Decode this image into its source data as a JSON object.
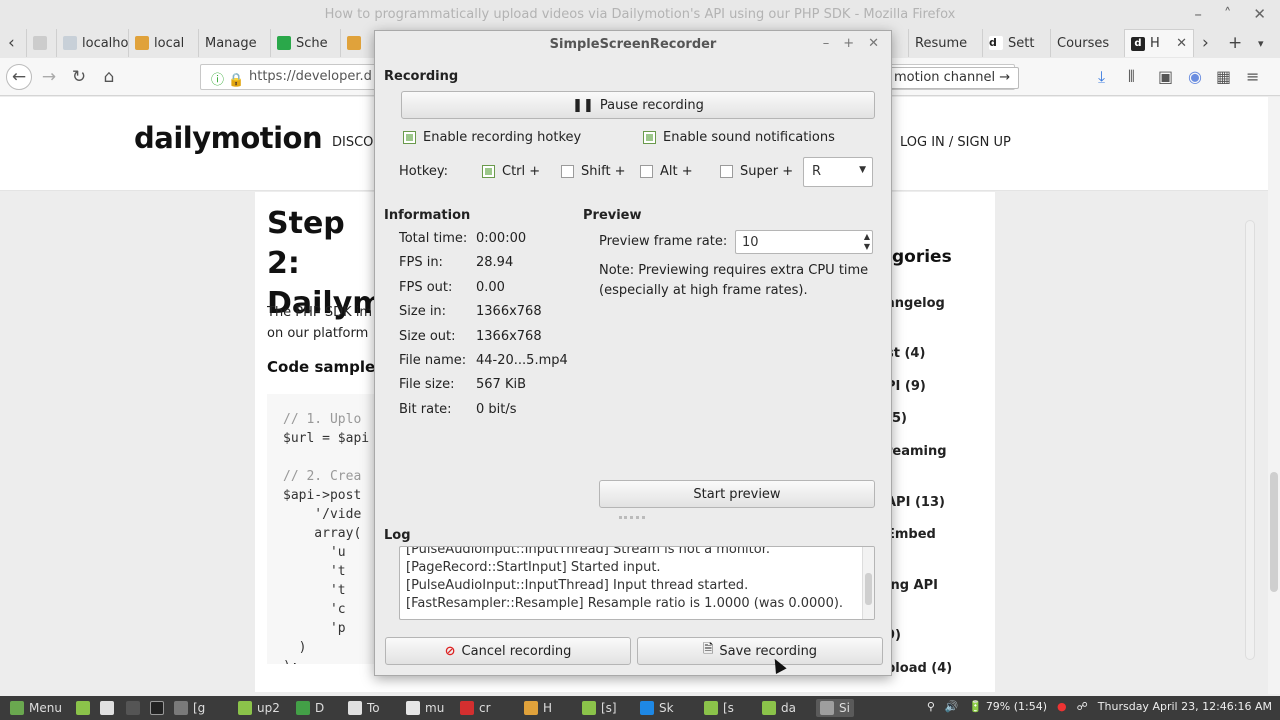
{
  "browser": {
    "window_title": "How to programmatically upload videos via Dailymotion's API using our PHP SDK - Mozilla Firefox",
    "tabs": [
      {
        "label": "localho",
        "icon_color": "#9aa5b1"
      },
      {
        "label": "local",
        "icon_color": "#e0a23b"
      },
      {
        "label": "Manage",
        "icon_color": "#e6e6e6"
      },
      {
        "label": "Sche",
        "icon_color": "#2aa84a"
      },
      {
        "label": "Resume",
        "icon_color": "#e0a23b"
      },
      {
        "label": "Sett",
        "icon_color": "#222222"
      },
      {
        "label": "Courses",
        "icon_color": "#e6e6e6"
      },
      {
        "label": "H",
        "icon_color": "#222222"
      }
    ],
    "url": "https://developer.d",
    "url_chip": "motion channel"
  },
  "website": {
    "logo": "dailymotion",
    "nav_text": "DISCO",
    "login": "LOG IN / SIGN UP",
    "step_title": "Step 2: Dailym",
    "intro": "The PHP SDK im on our platform",
    "code_header": "Code sample",
    "code_lines": [
      {
        "t": "// 1. Uplo",
        "c": true
      },
      {
        "t": "$url = $api",
        "c": false
      },
      {
        "t": "",
        "c": false
      },
      {
        "t": "// 2. Crea",
        "c": true
      },
      {
        "t": "$api->post",
        "c": false
      },
      {
        "t": "    '/vide",
        "c": false
      },
      {
        "t": "    array(",
        "c": false
      },
      {
        "t": "      'u",
        "c": false
      },
      {
        "t": "      't",
        "c": false
      },
      {
        "t": "      't",
        "c": false
      },
      {
        "t": "      'c",
        "c": false
      },
      {
        "t": "      'p",
        "c": false
      },
      {
        "t": "  )",
        "c": false
      },
      {
        "t": ");",
        "c": false
      }
    ],
    "categories_title": "gories",
    "categories": [
      "angelog",
      "st (4)",
      "PI (9)",
      "(5)",
      "reaming",
      "API (13)",
      "Embed",
      "ing API",
      "9)",
      "pload (4)"
    ]
  },
  "recorder": {
    "title": "SimpleScreenRecorder",
    "recording_label": "Recording",
    "pause_button": "Pause recording",
    "enable_hotkey": "Enable recording hotkey",
    "enable_sound": "Enable sound notifications",
    "hotkey_label": "Hotkey:",
    "ctrl": "Ctrl +",
    "shift": "Shift +",
    "alt": "Alt +",
    "super": "Super +",
    "hotkey_key": "R",
    "information_label": "Information",
    "info": [
      {
        "label": "Total time:",
        "value": "0:00:00"
      },
      {
        "label": "FPS in:",
        "value": "28.94"
      },
      {
        "label": "FPS out:",
        "value": "0.00"
      },
      {
        "label": "Size in:",
        "value": "1366x768"
      },
      {
        "label": "Size out:",
        "value": "1366x768"
      },
      {
        "label": "File name:",
        "value": "44-20...5.mp4"
      },
      {
        "label": "File size:",
        "value": "567 KiB"
      },
      {
        "label": "Bit rate:",
        "value": "0 bit/s"
      }
    ],
    "preview_label": "Preview",
    "preview_rate_label": "Preview frame rate:",
    "preview_rate_value": "10",
    "preview_note": "Note: Previewing requires extra CPU time (especially at high frame rates).",
    "start_preview": "Start preview",
    "log_label": "Log",
    "log_lines": [
      "[PulseAudioInput::InputThread] Stream is not a monitor.",
      "[PageRecord::StartInput] Started input.",
      "[PulseAudioInput::InputThread] Input thread started.",
      "[FastResampler::Resample] Resample ratio is 1.0000 (was 0.0000)."
    ],
    "cancel_button": "Cancel recording",
    "save_button": "Save recording"
  },
  "taskbar": {
    "menu": "Menu",
    "items": [
      {
        "label": "[g",
        "color": "#7a7a7a"
      },
      {
        "label": "up2",
        "color": "#8bc34a"
      },
      {
        "label": "D",
        "color": "#43a047"
      },
      {
        "label": "To",
        "color": "#e0e0e0"
      },
      {
        "label": "mu",
        "color": "#e6e6e6"
      },
      {
        "label": "cr",
        "color": "#d32f2f"
      },
      {
        "label": "H",
        "color": "#e0a23b"
      },
      {
        "label": "[s]",
        "color": "#8bc34a"
      },
      {
        "label": "Sk",
        "color": "#1e88e5"
      },
      {
        "label": "[s",
        "color": "#8bc34a"
      },
      {
        "label": "da",
        "color": "#8bc34a"
      },
      {
        "label": "Si",
        "color": "#9e9e9e"
      }
    ],
    "battery": "79% (1:54)",
    "clock": "Thursday April 23, 12:46:16 AM"
  }
}
